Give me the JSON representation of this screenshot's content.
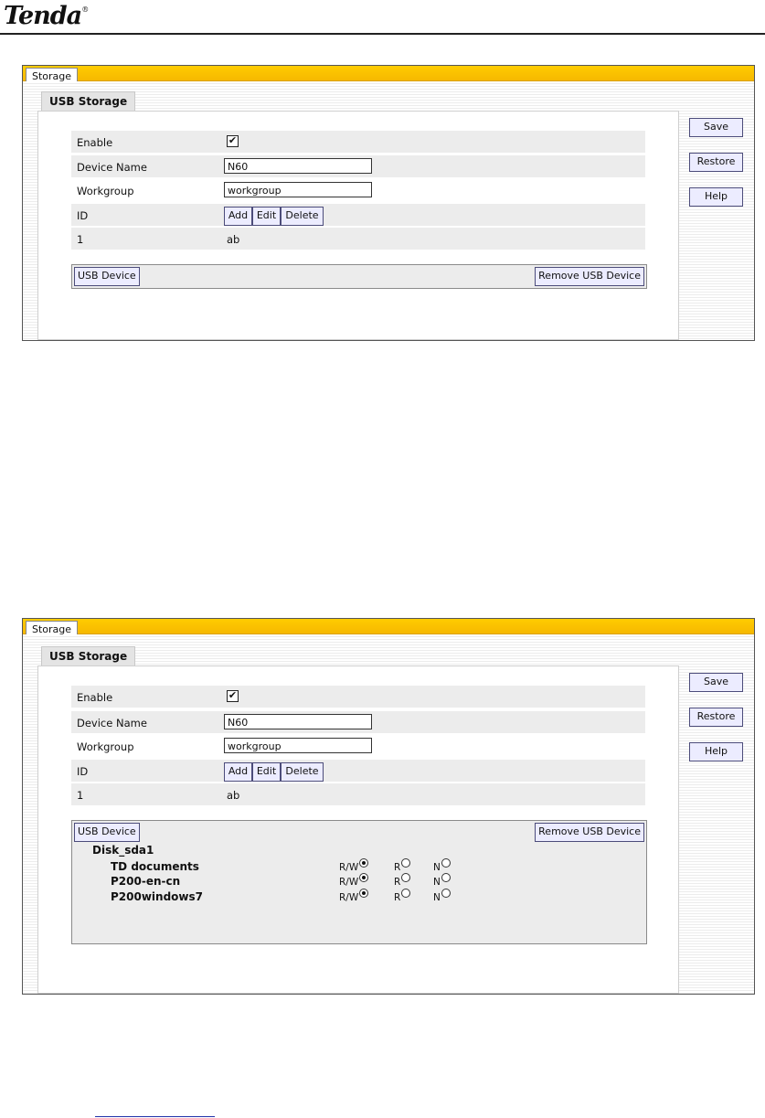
{
  "header": {
    "brand": "Tenda",
    "trademark": "®"
  },
  "screens": [
    {
      "tab_label": "Storage",
      "section_title": "USB Storage",
      "buttons": {
        "save": "Save",
        "restore": "Restore",
        "help": "Help"
      },
      "form": {
        "enable_label": "Enable",
        "enable_checked": true,
        "check_mark": "✔",
        "device_name_label": "Device Name",
        "device_name_value": "N60",
        "workgroup_label": "Workgroup",
        "workgroup_value": "workgroup",
        "id_label": "ID",
        "add": "Add",
        "edit": "Edit",
        "delete": "Delete",
        "id_row": {
          "id": "1",
          "name": "ab"
        }
      },
      "usb": {
        "device_button": "USB Device",
        "remove_button": "Remove USB Device"
      }
    },
    {
      "tab_label": "Storage",
      "section_title": "USB Storage",
      "buttons": {
        "save": "Save",
        "restore": "Restore",
        "help": "Help"
      },
      "form": {
        "enable_label": "Enable",
        "enable_checked": true,
        "check_mark": "✔",
        "device_name_label": "Device Name",
        "device_name_value": "N60",
        "workgroup_label": "Workgroup",
        "workgroup_value": "workgroup",
        "id_label": "ID",
        "add": "Add",
        "edit": "Edit",
        "delete": "Delete",
        "id_row": {
          "id": "1",
          "name": "ab"
        }
      },
      "usb": {
        "device_button": "USB Device",
        "remove_button": "Remove USB Device",
        "disk": "Disk_sda1",
        "perm_labels": {
          "rw": "R/W",
          "r": "R",
          "n": "N"
        },
        "shares": [
          {
            "name": "TD documents",
            "selected": "rw"
          },
          {
            "name": "P200-en-cn",
            "selected": "rw"
          },
          {
            "name": "P200windows7",
            "selected": "rw"
          }
        ]
      }
    }
  ]
}
